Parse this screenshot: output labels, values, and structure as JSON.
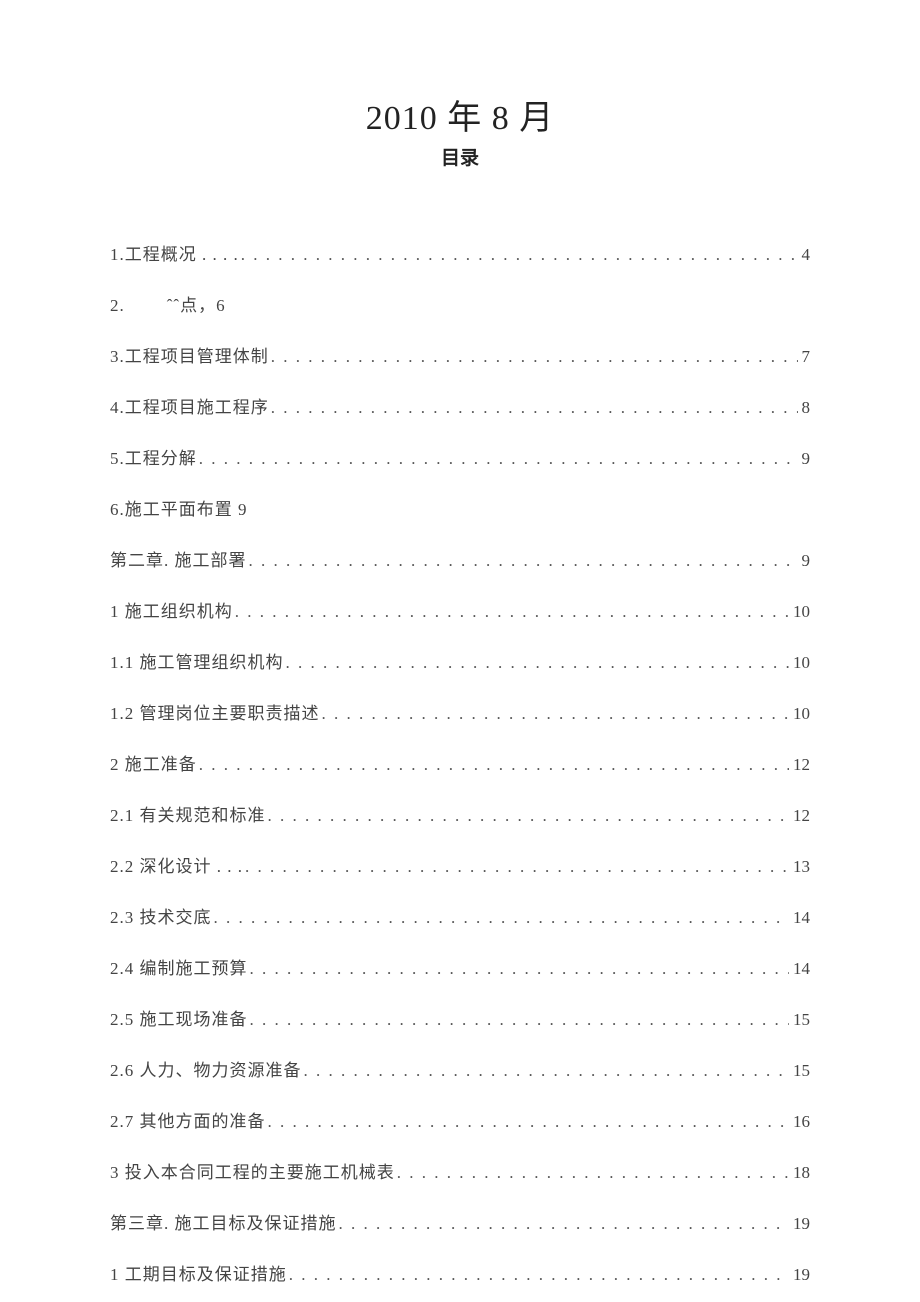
{
  "header": {
    "title": "2010 年 8 月",
    "subtitle": "目录"
  },
  "toc": [
    {
      "label": "1.工程概况 . . . .",
      "page": "4",
      "dots": true
    },
    {
      "label": "2.        ˆˆ点，6",
      "page": "",
      "dots": false
    },
    {
      "label": "3.工程项目管理体制",
      "page": "7",
      "dots": true
    },
    {
      "label": "4.工程项目施工程序",
      "page": "8",
      "dots": true
    },
    {
      "label": "5.工程分解",
      "page": "9",
      "dots": true
    },
    {
      "label": "6.施工平面布置 9",
      "page": "",
      "dots": false
    },
    {
      "label": "第二章. 施工部署",
      "page": "9",
      "dots": true
    },
    {
      "label": "1 施工组织机构",
      "page": "10",
      "dots": true
    },
    {
      "label": "1.1 施工管理组织机构",
      "page": "10",
      "dots": true
    },
    {
      "label": "1.2 管理岗位主要职责描述",
      "page": "10",
      "dots": true
    },
    {
      "label": "2 施工准备",
      "page": "12",
      "dots": true
    },
    {
      "label": "2.1 有关规范和标准",
      "page": "12",
      "dots": true
    },
    {
      "label": "2.2 深化设计 . . .",
      "page": "13",
      "dots": true
    },
    {
      "label": "2.3 技术交底",
      "page": "14",
      "dots": true
    },
    {
      "label": "2.4 编制施工预算",
      "page": "14",
      "dots": true
    },
    {
      "label": "2.5 施工现场准备",
      "page": "15",
      "dots": true
    },
    {
      "label": "2.6 人力、物力资源准备",
      "page": "15",
      "dots": true
    },
    {
      "label": "2.7 其他方面的准备",
      "page": "16",
      "dots": true
    },
    {
      "label": "3 投入本合同工程的主要施工机械表",
      "page": "18",
      "dots": true
    },
    {
      "label": "第三章. 施工目标及保证措施",
      "page": "19",
      "dots": true
    },
    {
      "label": "1 工期目标及保证措施",
      "page": "19",
      "dots": true
    }
  ]
}
